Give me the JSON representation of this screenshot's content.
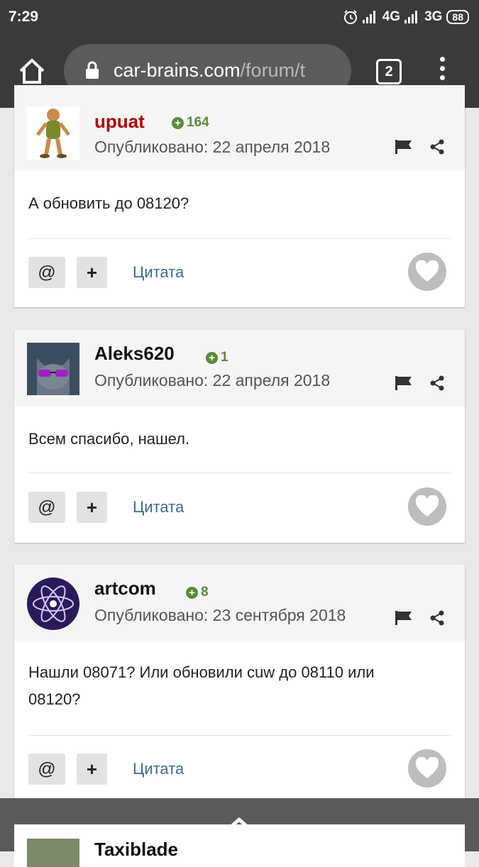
{
  "status_bar": {
    "time": "7:29",
    "network_1": "4G",
    "network_2": "3G",
    "battery": "88"
  },
  "browser": {
    "url_domain": "car-brains.com",
    "url_path": "/forum/t",
    "tab_count": "2"
  },
  "posts": [
    {
      "author": "upuat",
      "author_color": "#b30000",
      "reputation": "164",
      "date": "Опубликовано: 22 апреля 2018",
      "body": "А обновить до 08120?",
      "mention_label": "@",
      "plus_label": "+",
      "quote_label": "Цитата"
    },
    {
      "author": "Aleks620",
      "author_color": "#111111",
      "reputation": "1",
      "date": "Опубликовано: 22 апреля 2018",
      "body": "Всем спасибо, нашел.",
      "mention_label": "@",
      "plus_label": "+",
      "quote_label": "Цитата"
    },
    {
      "author": "artcom",
      "author_color": "#111111",
      "reputation": "8",
      "date": "Опубликовано: 23 сентября 2018",
      "body": "Нашли 08071? Или обновили cuw до 08110 или 08120?",
      "mention_label": "@",
      "plus_label": "+",
      "quote_label": "Цитата"
    }
  ],
  "next_post": {
    "author": "Taxiblade"
  },
  "colors": {
    "reputation_green": "#5b8a3a",
    "quote_blue": "#3d6a9b",
    "chrome_dark": "#3a3a3a"
  },
  "icons": [
    "home-icon",
    "lock-icon",
    "menu-icon",
    "flag-icon",
    "share-icon",
    "heart-icon",
    "chevron-up-icon"
  ]
}
